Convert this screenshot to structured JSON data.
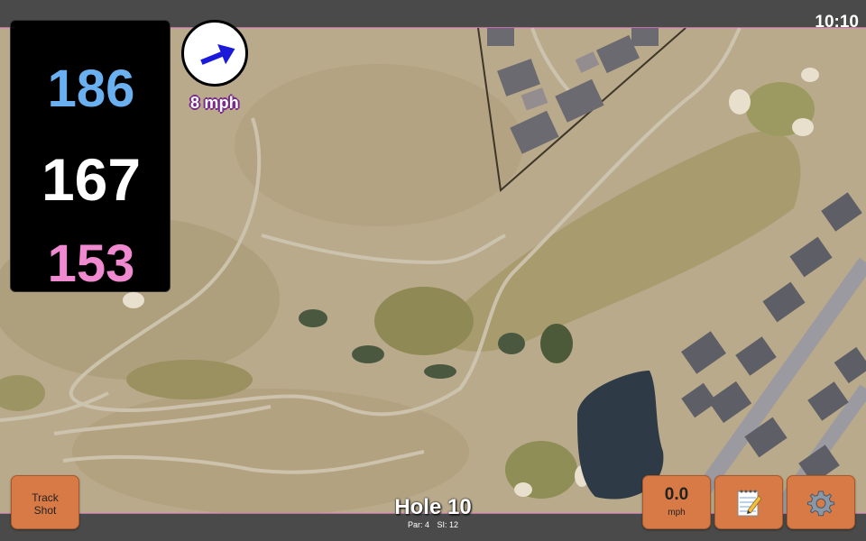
{
  "status": {
    "time": "10:10"
  },
  "distances": {
    "back": {
      "value": "186",
      "color": "#6ab0f0"
    },
    "middle": {
      "value": "167",
      "color": "#ffffff"
    },
    "front": {
      "value": "153",
      "color": "#f08ad0"
    }
  },
  "wind": {
    "label": "8 mph",
    "arrow_color": "#1a1ad8",
    "icon": "wind-direction-arrow-icon"
  },
  "buttons": {
    "track_shot": {
      "line1": "Track",
      "line2": "Shot"
    },
    "wind_speed": {
      "value": "0.0",
      "unit": "mph"
    },
    "notes": {
      "icon": "notepad-icon"
    },
    "settings": {
      "icon": "gear-icon"
    }
  },
  "hole": {
    "title": "Hole 10",
    "par": "Par: 4",
    "si": "SI: 12"
  },
  "theme": {
    "button_color": "#d87a45",
    "accent": "#c46ab0"
  }
}
